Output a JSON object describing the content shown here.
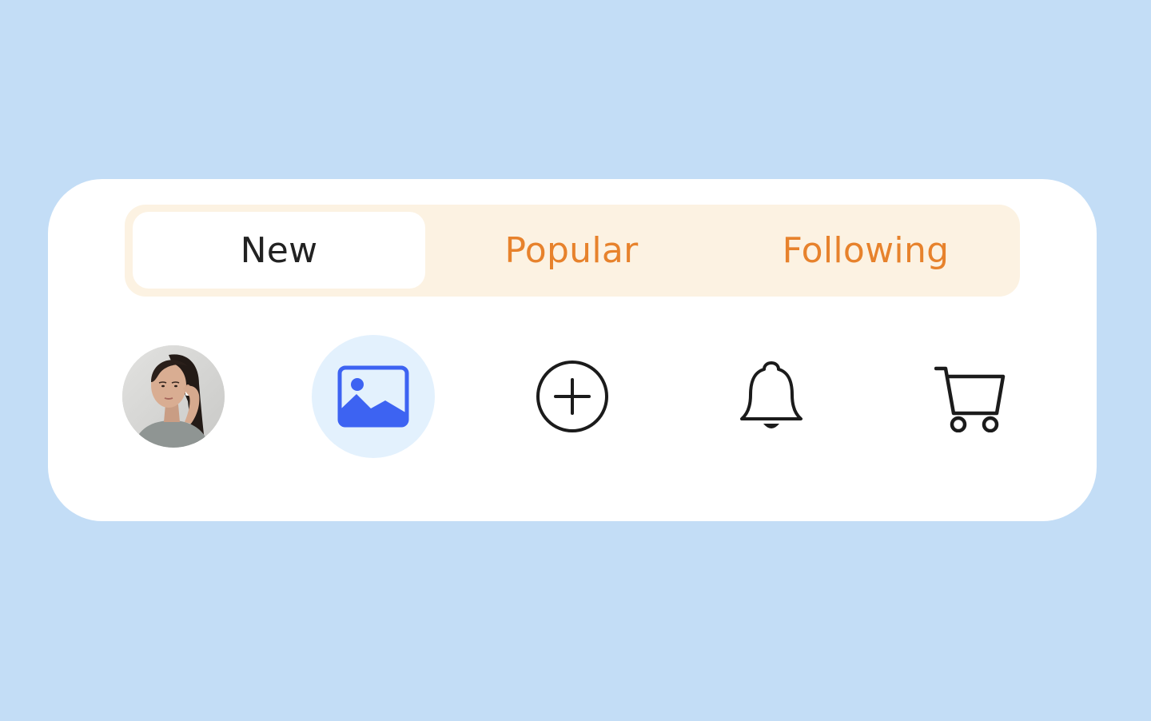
{
  "tabs": [
    {
      "label": "New",
      "active": true
    },
    {
      "label": "Popular",
      "active": false
    },
    {
      "label": "Following",
      "active": false
    }
  ],
  "nav_icons": [
    "avatar",
    "image-icon",
    "plus-circle-icon",
    "bell-icon",
    "cart-icon"
  ],
  "colors": {
    "page_background": "#c3ddf6",
    "card_background": "#ffffff",
    "segmented_background": "#fcf2e2",
    "inactive_tab_text": "#e7822c",
    "active_tab_text": "#222222",
    "accent_blue": "#3d63f2",
    "selected_icon_background": "#e3f1fd",
    "icon_stroke": "#1b1b1b"
  }
}
